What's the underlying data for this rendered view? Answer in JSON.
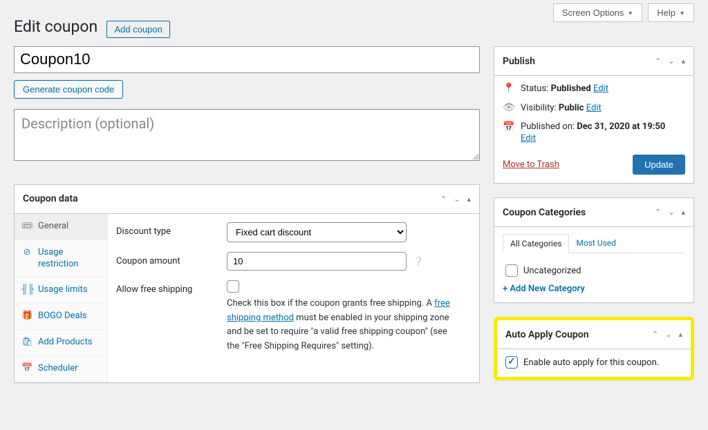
{
  "top": {
    "screen_options": "Screen Options",
    "help": "Help"
  },
  "header": {
    "title": "Edit coupon",
    "add_coupon": "Add coupon"
  },
  "coupon": {
    "code": "Coupon10",
    "generate_btn": "Generate coupon code",
    "desc_placeholder": "Description (optional)"
  },
  "coupon_data": {
    "box_title": "Coupon data",
    "tabs": {
      "general": "General",
      "usage_restriction": "Usage restriction",
      "usage_limits": "Usage limits",
      "bogo": "BOGO Deals",
      "add_products": "Add Products",
      "scheduler": "Scheduler"
    },
    "discount_type_label": "Discount type",
    "discount_type_value": "Fixed cart discount",
    "amount_label": "Coupon amount",
    "amount_value": "10",
    "free_ship_label": "Allow free shipping",
    "free_ship_help_before": "Check this box if the coupon grants free shipping. A ",
    "free_ship_link": "free shipping method",
    "free_ship_help_after": " must be enabled in your shipping zone and be set to require \"a valid free shipping coupon\" (see the \"Free Shipping Requires\" setting)."
  },
  "publish": {
    "box_title": "Publish",
    "status_label": "Status:",
    "status_value": "Published",
    "visibility_label": "Visibility:",
    "visibility_value": "Public",
    "published_label": "Published on:",
    "published_value": "Dec 31, 2020 at 19:50",
    "edit": "Edit",
    "trash": "Move to Trash",
    "update": "Update"
  },
  "categories": {
    "box_title": "Coupon Categories",
    "tab_all": "All Categories",
    "tab_most": "Most Used",
    "uncategorized": "Uncategorized",
    "add_new": "+ Add New Category"
  },
  "auto_apply": {
    "box_title": "Auto Apply Coupon",
    "label": "Enable auto apply for this coupon."
  }
}
